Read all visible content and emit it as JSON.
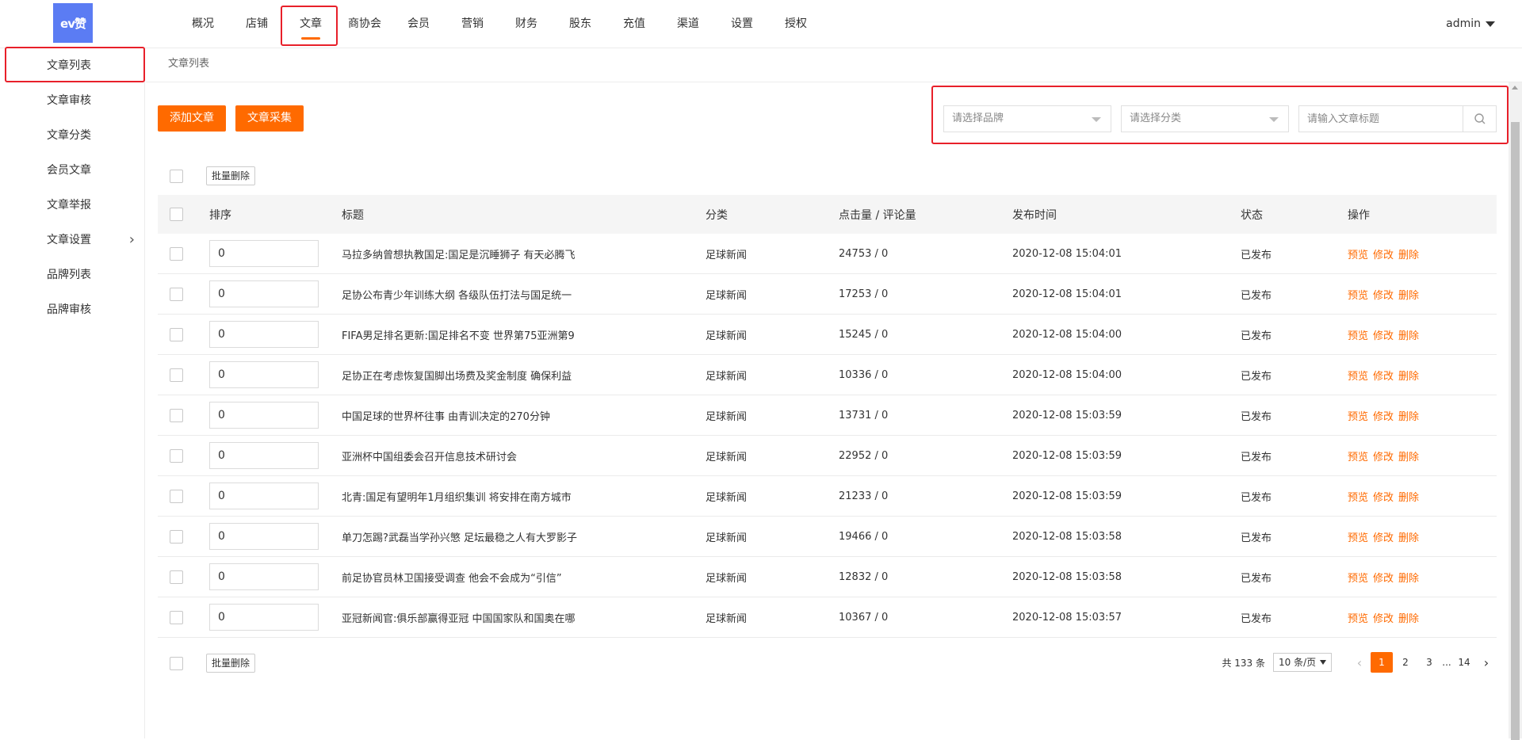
{
  "logo": {
    "text": "ev赞"
  },
  "nav": {
    "items": [
      "概况",
      "店铺",
      "文章",
      "商协会",
      "会员",
      "营销",
      "财务",
      "股东",
      "充值",
      "渠道",
      "设置",
      "授权"
    ],
    "active_index": 2
  },
  "user": {
    "name": "admin"
  },
  "sidebar": {
    "items": [
      "文章列表",
      "文章审核",
      "文章分类",
      "会员文章",
      "文章举报",
      "文章设置",
      "品牌列表",
      "品牌审核"
    ],
    "active_index": 0,
    "expandable_index": 5
  },
  "breadcrumb": {
    "current": "文章列表"
  },
  "toolbar": {
    "add_label": "添加文章",
    "collect_label": "文章采集"
  },
  "filters": {
    "brand_placeholder": "请选择品牌",
    "category_placeholder": "请选择分类",
    "search_placeholder": "请输入文章标题"
  },
  "batch_delete_label": "批量删除",
  "table": {
    "headers": {
      "sort": "排序",
      "title": "标题",
      "category": "分类",
      "clicks": "点击量 / 评论量",
      "time": "发布时间",
      "status": "状态",
      "ops": "操作"
    },
    "op_labels": {
      "preview": "预览",
      "edit": "修改",
      "delete": "删除"
    },
    "rows": [
      {
        "sort": "0",
        "title": "马拉多纳曾想执教国足:国足是沉睡狮子 有天必腾飞",
        "category": "足球新闻",
        "clicks": "24753 / 0",
        "time": "2020-12-08 15:04:01",
        "status": "已发布"
      },
      {
        "sort": "0",
        "title": "足协公布青少年训练大纲 各级队伍打法与国足统一",
        "category": "足球新闻",
        "clicks": "17253 / 0",
        "time": "2020-12-08 15:04:01",
        "status": "已发布"
      },
      {
        "sort": "0",
        "title": "FIFA男足排名更新:国足排名不变 世界第75亚洲第9",
        "category": "足球新闻",
        "clicks": "15245 / 0",
        "time": "2020-12-08 15:04:00",
        "status": "已发布"
      },
      {
        "sort": "0",
        "title": "足协正在考虑恢复国脚出场费及奖金制度 确保利益",
        "category": "足球新闻",
        "clicks": "10336 / 0",
        "time": "2020-12-08 15:04:00",
        "status": "已发布"
      },
      {
        "sort": "0",
        "title": "中国足球的世界杯往事 由青训决定的270分钟",
        "category": "足球新闻",
        "clicks": "13731 / 0",
        "time": "2020-12-08 15:03:59",
        "status": "已发布"
      },
      {
        "sort": "0",
        "title": "亚洲杯中国组委会召开信息技术研讨会",
        "category": "足球新闻",
        "clicks": "22952 / 0",
        "time": "2020-12-08 15:03:59",
        "status": "已发布"
      },
      {
        "sort": "0",
        "title": "北青:国足有望明年1月组织集训 将安排在南方城市",
        "category": "足球新闻",
        "clicks": "21233 / 0",
        "time": "2020-12-08 15:03:59",
        "status": "已发布"
      },
      {
        "sort": "0",
        "title": "单刀怎踢?武磊当学孙兴慜 足坛最稳之人有大罗影子",
        "category": "足球新闻",
        "clicks": "19466 / 0",
        "time": "2020-12-08 15:03:58",
        "status": "已发布"
      },
      {
        "sort": "0",
        "title": "前足协官员林卫国接受调查 他会不会成为“引信”",
        "category": "足球新闻",
        "clicks": "12832 / 0",
        "time": "2020-12-08 15:03:58",
        "status": "已发布"
      },
      {
        "sort": "0",
        "title": "亚冠新闻官:俱乐部赢得亚冠 中国国家队和国奥在哪",
        "category": "足球新闻",
        "clicks": "10367 / 0",
        "time": "2020-12-08 15:03:57",
        "status": "已发布"
      }
    ]
  },
  "pagination": {
    "total_text": "共 133 条",
    "page_size": "10 条/页",
    "pages": [
      "1",
      "2",
      "3"
    ],
    "ellipsis": "...",
    "last_page": "14",
    "current": 1,
    "prev_icon": "‹",
    "next_icon": "›"
  },
  "colors": {
    "accent": "#ff6a00",
    "annotation": "#e8202a",
    "logo_bg": "#5b7cf3"
  }
}
